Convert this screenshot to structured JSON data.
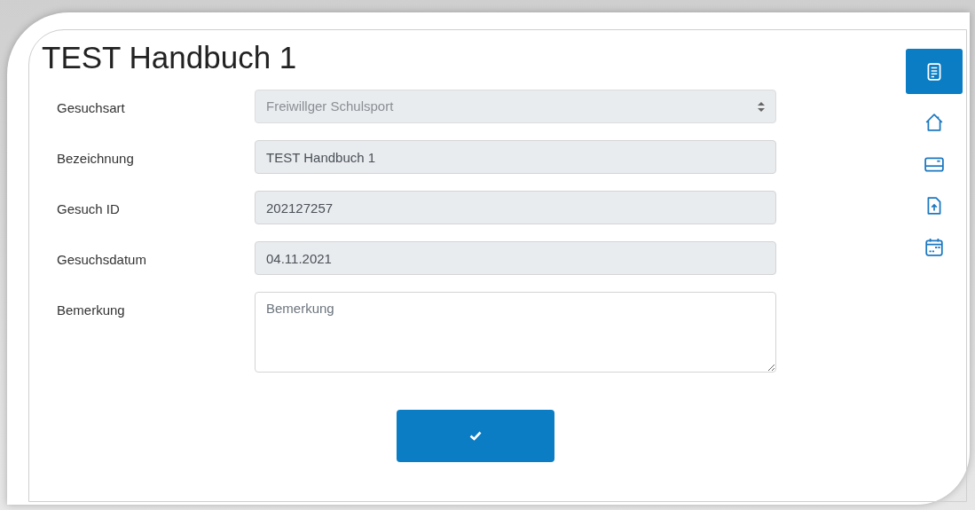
{
  "title": "TEST Handbuch 1",
  "fields": [
    {
      "kind": "select",
      "label": "Gesuchsart",
      "value": "Freiwillger Schulsport",
      "disabled": true
    },
    {
      "kind": "input",
      "label": "Bezeichnung",
      "value": "TEST Handbuch 1",
      "disabled": true
    },
    {
      "kind": "input",
      "label": "Gesuch ID",
      "value": "202127257",
      "disabled": true
    },
    {
      "kind": "input",
      "label": "Gesuchsdatum",
      "value": "04.11.2021",
      "disabled": true
    },
    {
      "kind": "textarea",
      "label": "Bemerkung",
      "placeholder": "Bemerkung",
      "disabled": false
    }
  ],
  "side_nav": [
    {
      "kind": "document",
      "selected": true
    },
    {
      "kind": "home",
      "selected": false
    },
    {
      "kind": "card",
      "selected": false
    },
    {
      "kind": "upload",
      "selected": false
    },
    {
      "kind": "calendar",
      "selected": false
    }
  ]
}
